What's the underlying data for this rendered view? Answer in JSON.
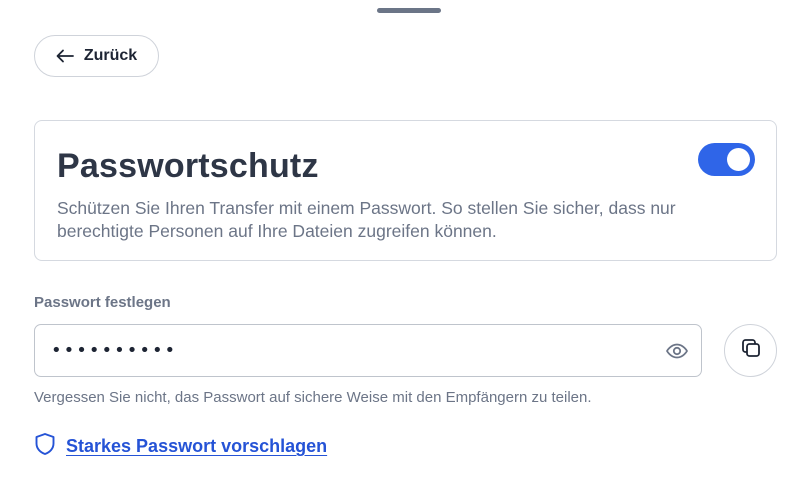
{
  "header": {
    "back_label": "Zurück"
  },
  "protection": {
    "title": "Passwortschutz",
    "description": "Schützen Sie Ihren Transfer mit einem Passwort. So stellen Sie sicher, dass nur berechtigte Personen auf Ihre Dateien zugreifen können.",
    "enabled": true
  },
  "password": {
    "label": "Passwort festlegen",
    "masked_value": "••••••••••",
    "hint": "Vergessen Sie nicht, das Passwort auf sichere Weise mit den Empfängern zu teilen."
  },
  "suggest": {
    "label": "Starkes Passwort vorschlagen"
  },
  "colors": {
    "accent": "#2f65e8",
    "link": "#2553d6",
    "muted_text": "#6c7587"
  }
}
